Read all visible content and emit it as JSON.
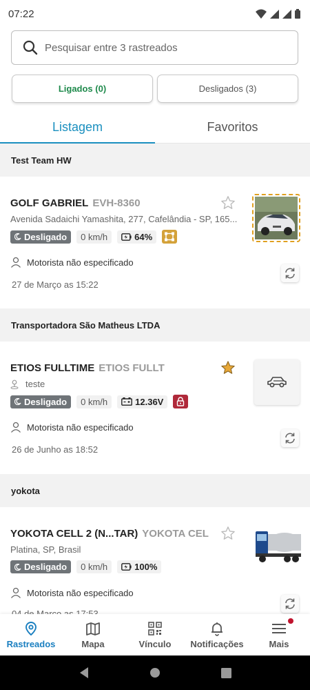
{
  "status": {
    "time": "07:22"
  },
  "search": {
    "placeholder": "Pesquisar entre 3 rastreados"
  },
  "filters": {
    "on_label": "Ligados (0)",
    "off_label": "Desligados (3)"
  },
  "tabs": [
    {
      "label": "Listagem",
      "active": true
    },
    {
      "label": "Favoritos",
      "active": false
    }
  ],
  "groups": [
    {
      "name": "Test Team HW",
      "vehicle": {
        "name": "GOLF GABRIEL",
        "plate": "EVH-8360",
        "address": "Avenida Sadaichi Yamashita, 277, Cafelândia - SP, 165...",
        "status": "Desligado",
        "speed": "0 km/h",
        "power": "64%",
        "driver": "Motorista não especificado",
        "date": "27 de Março as 15:22",
        "favorite": false
      }
    },
    {
      "name": "Transportadora São Matheus LTDA",
      "vehicle": {
        "name": "ETIOS FULLTIME",
        "plate": "ETIOS FULLT",
        "address": "teste",
        "status": "Desligado",
        "speed": "0 km/h",
        "power": "12.36V",
        "driver": "Motorista não especificado",
        "date": "26 de Junho as 18:52",
        "favorite": true
      }
    },
    {
      "name": "yokota",
      "vehicle": {
        "name": "YOKOTA CELL 2 (N...TAR)",
        "plate": "YOKOTA CEL",
        "address": "Platina, SP, Brasil",
        "status": "Desligado",
        "speed": "0 km/h",
        "power": "100%",
        "driver": "Motorista não especificado",
        "date": "04 de Março as 17:53",
        "favorite": false
      }
    }
  ],
  "nav": [
    {
      "label": "Rastreados",
      "icon": "map-pin-icon",
      "active": true
    },
    {
      "label": "Mapa",
      "icon": "map-icon",
      "active": false
    },
    {
      "label": "Vínculo",
      "icon": "qr-code-icon",
      "active": false
    },
    {
      "label": "Notificações",
      "icon": "bell-icon",
      "active": false
    },
    {
      "label": "Mais",
      "icon": "menu-icon",
      "active": false
    }
  ],
  "colors": {
    "accent": "#1a8fbf",
    "on_green": "#1f8a4c",
    "off_chip": "#6f7478",
    "star": "#e8a838",
    "lock_red": "#b0293a",
    "badge_red": "#c0132d"
  }
}
